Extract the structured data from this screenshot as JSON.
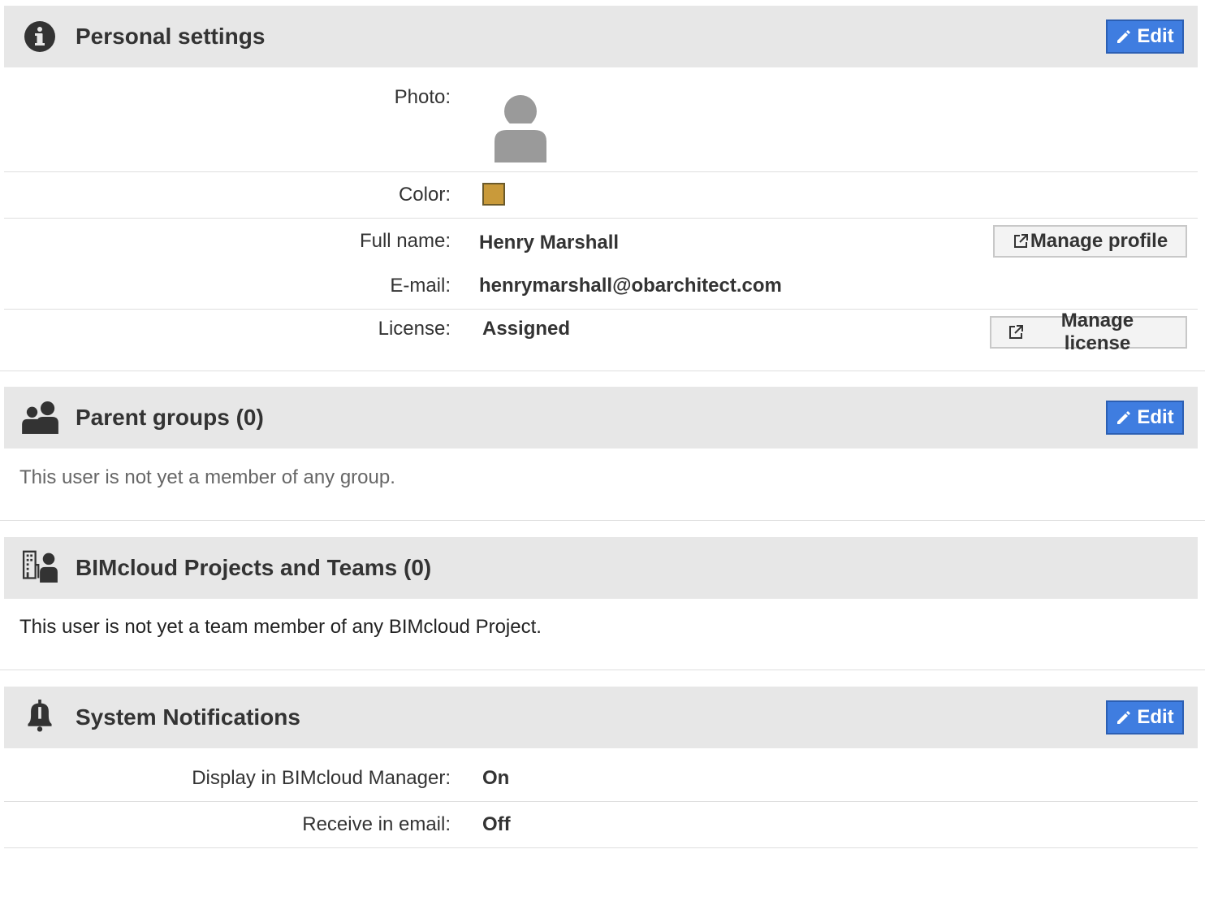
{
  "personal_settings": {
    "title": "Personal settings",
    "edit_label": "Edit",
    "photo_label": "Photo:",
    "color_label": "Color:",
    "color_value": "#c99a3a",
    "full_name_label": "Full name:",
    "full_name_value": "Henry Marshall",
    "manage_profile_label": "Manage profile",
    "email_label": "E-mail:",
    "email_value": "henrymarshall@obarchitect.com",
    "license_label": "License:",
    "license_value": "Assigned",
    "manage_license_label": "Manage license"
  },
  "parent_groups": {
    "title": "Parent groups (0)",
    "edit_label": "Edit",
    "empty_text": "This user is not yet a member of any group."
  },
  "projects_teams": {
    "title": "BIMcloud Projects and Teams (0)",
    "empty_text": "This user is not yet a team member of any BIMcloud Project."
  },
  "system_notifications": {
    "title": "System Notifications",
    "edit_label": "Edit",
    "display_label": "Display in BIMcloud Manager:",
    "display_value": "On",
    "email_label": "Receive in email:",
    "email_value": "Off"
  },
  "colors": {
    "header_bg": "#e7e7e7",
    "edit_button_bg": "#3f7de0",
    "text": "#333333"
  }
}
